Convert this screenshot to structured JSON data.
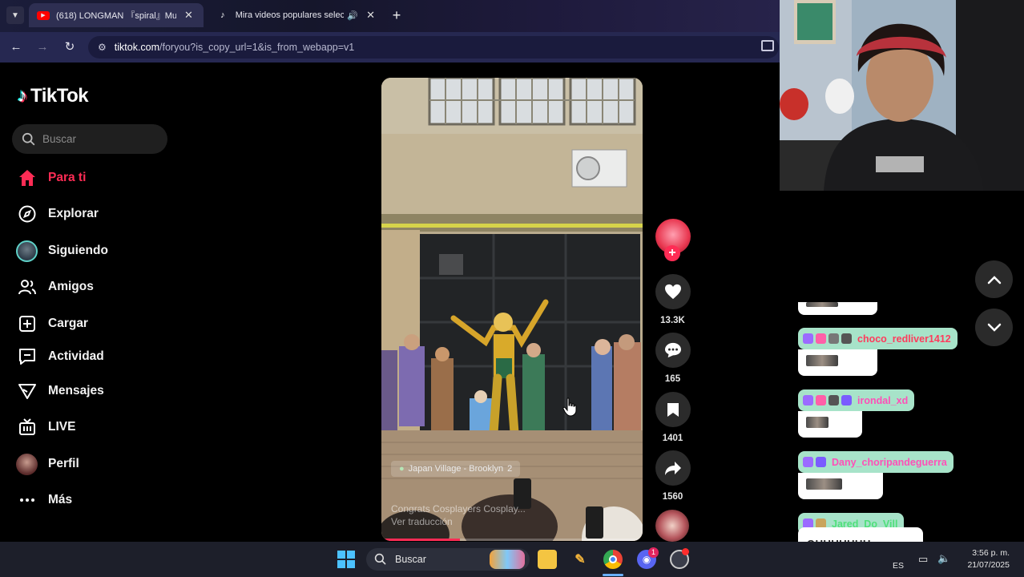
{
  "browser": {
    "tabs": [
      {
        "title": "(618) LONGMAN 『spiral』Music",
        "favicon": "youtube-icon",
        "active": true
      },
      {
        "title": "Mira videos populares selec",
        "favicon": "tiktok-icon",
        "active": false,
        "audio": true
      }
    ],
    "url_host": "tiktok.com",
    "url_path": "/foryou?is_copy_url=1&is_from_webapp=v1"
  },
  "tiktok": {
    "logo_text": "TikTok",
    "search_placeholder": "Buscar",
    "nav": [
      {
        "label": "Para ti",
        "icon": "home-icon",
        "active": true
      },
      {
        "label": "Explorar",
        "icon": "compass-icon"
      },
      {
        "label": "Siguiendo",
        "icon": "avatar"
      },
      {
        "label": "Amigos",
        "icon": "friends-icon"
      },
      {
        "label": "Cargar",
        "icon": "upload-icon"
      },
      {
        "label": "Actividad",
        "icon": "activity-icon"
      },
      {
        "label": "Mensajes",
        "icon": "messages-icon"
      },
      {
        "label": "LIVE",
        "icon": "live-icon"
      },
      {
        "label": "Perfil",
        "icon": "avatar"
      },
      {
        "label": "Más",
        "icon": "more-icon"
      }
    ],
    "video": {
      "location": "Japan Village - Brooklyn",
      "location_count": "2",
      "caption_line1": "Congrats Cosplayers Cosplay...",
      "caption_line2": "Ver traducción",
      "progress": 0.3
    },
    "actions": {
      "likes": "13.3K",
      "comments": "165",
      "saves": "1401",
      "shares": "1560"
    }
  },
  "chat": [
    {
      "username": "choco_redliver1412",
      "color": "#ff3b5c"
    },
    {
      "username": "irondal_xd",
      "color": "#ff4fb8"
    },
    {
      "username": "Dany_choripandeguerra",
      "color": "#ff4fb8"
    },
    {
      "username": "Jared_Do_Vill",
      "color": "#4fe07a",
      "message": "OUUUUUUU"
    }
  ],
  "taskbar": {
    "search_label": "Buscar",
    "language": "ES",
    "time": "3:56 p. m.",
    "date": "21/07/2025",
    "discord_badge": "1"
  },
  "colors": {
    "tiktok_accent": "#fe2c55",
    "chat_name_bg": "#a7e3c9"
  }
}
